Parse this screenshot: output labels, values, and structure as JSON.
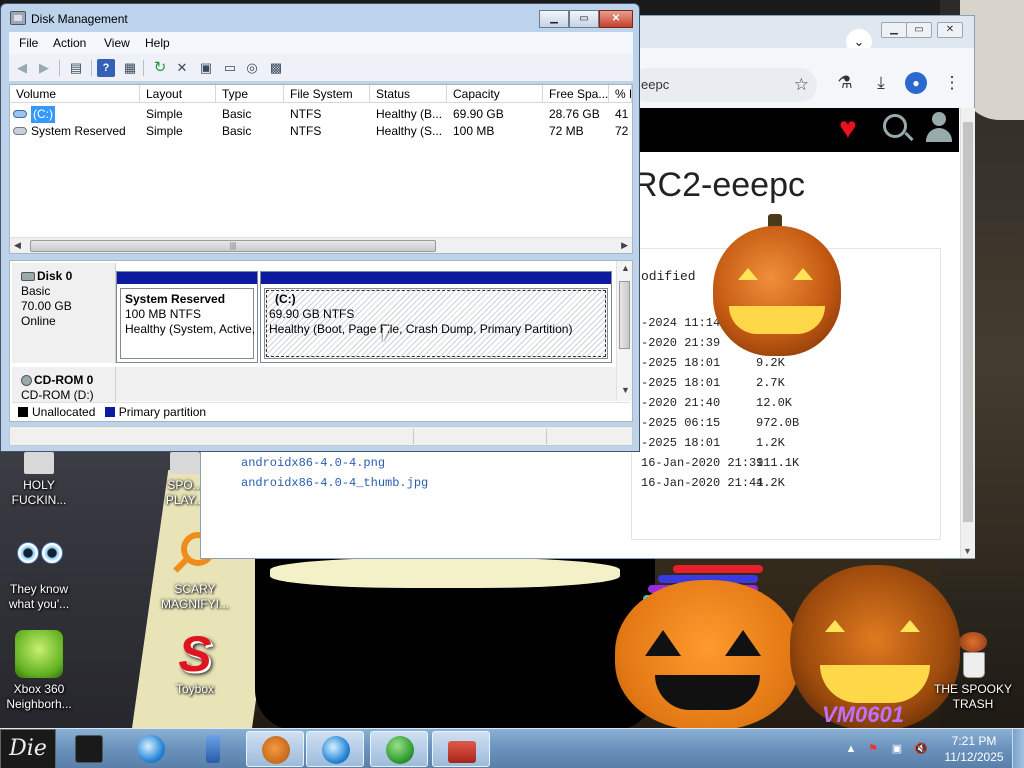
{
  "disk_management": {
    "title": "Disk Management",
    "menu": [
      "File",
      "Action",
      "View",
      "Help"
    ],
    "window_buttons": {
      "minimize": "▁",
      "maximize": "▭",
      "close": "✕"
    },
    "columns": [
      "Volume",
      "Layout",
      "Type",
      "File System",
      "Status",
      "Capacity",
      "Free Spa...",
      "% F"
    ],
    "volumes": [
      {
        "volume": "(C:)",
        "layout": "Simple",
        "type": "Basic",
        "fs": "NTFS",
        "status": "Healthy (B...",
        "capacity": "69.90 GB",
        "free": "28.76 GB",
        "pct": "41"
      },
      {
        "volume": "System Reserved",
        "layout": "Simple",
        "type": "Basic",
        "fs": "NTFS",
        "status": "Healthy (S...",
        "capacity": "100 MB",
        "free": "72 MB",
        "pct": "72"
      }
    ],
    "disks": [
      {
        "name": "Disk 0",
        "type": "Basic",
        "size": "70.00 GB",
        "state": "Online"
      },
      {
        "name": "CD-ROM 0",
        "drive": "CD-ROM (D:)"
      }
    ],
    "partitions": [
      {
        "name": "System Reserved",
        "size": "100 MB NTFS",
        "status": "Healthy (System, Active,"
      },
      {
        "name": "(C:)",
        "size": "69.90 GB NTFS",
        "status": "Healthy (Boot, Page File, Crash Dump, Primary Partition)"
      }
    ],
    "legend": [
      {
        "label": "Unallocated",
        "color": "#000000"
      },
      {
        "label": "Primary partition",
        "color": "#0c1aa0"
      }
    ]
  },
  "browser": {
    "address_partial": "eepc",
    "page_heading_partial": "RC2-eeepc",
    "listing_header_partial": "odified",
    "rows": [
      {
        "name": "",
        "date": "-2024 11:14",
        "size": ""
      },
      {
        "name": "",
        "date": "-2020 21:39",
        "size": ""
      },
      {
        "name": "",
        "date": "-2025 18:01",
        "size": "9.2K"
      },
      {
        "name": "",
        "date": "-2025 18:01",
        "size": "2.7K"
      },
      {
        "name": "",
        "date": "-2020 21:40",
        "size": "12.0K"
      },
      {
        "name": "",
        "date": "-2025 06:15",
        "size": "972.0B"
      },
      {
        "name": "",
        "date": "-2025 18:01",
        "size": "1.2K"
      },
      {
        "name": "androidx86-4.0-4.png",
        "date": "16-Jan-2020 21:39",
        "size": "111.1K"
      },
      {
        "name": "androidx86-4.0-4_thumb.jpg",
        "date": "16-Jan-2020 21:41",
        "size": "4.2K"
      }
    ]
  },
  "desktop_icons": [
    {
      "label": "HOLY FUCKIN...",
      "icon": "exe-icon"
    },
    {
      "label": "SPO... PLAY...",
      "icon": "exe-icon"
    },
    {
      "label": "They know what you'...",
      "icon": "eyes-icon"
    },
    {
      "label": "SCARY MAGNIFYI...",
      "icon": "magnifier-icon"
    },
    {
      "label": "Xbox 360 Neighborh...",
      "icon": "xbox-icon"
    },
    {
      "label": "Toybox",
      "icon": "toybox-icon"
    },
    {
      "label": "THE SPOOKY TRASH",
      "icon": "trash-icon"
    }
  ],
  "taskbar": {
    "start_label": "Die",
    "clock_time": "7:21 PM",
    "clock_date": "11/12/2025",
    "watermark": "VM0601"
  }
}
